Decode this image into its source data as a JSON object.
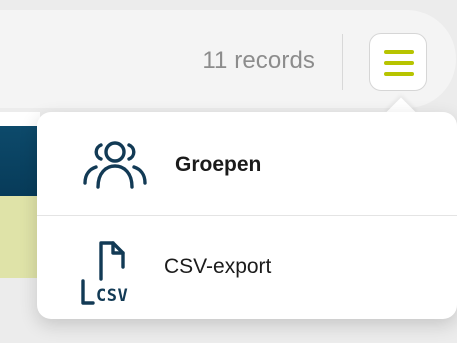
{
  "header": {
    "record_count": "11 records",
    "menu_button_icon": "hamburger-menu-icon",
    "accent_color": "#b7c400"
  },
  "menu": {
    "items": [
      {
        "label": "Groepen",
        "icon": "users-group-icon",
        "bold": true
      },
      {
        "label": "CSV-export",
        "icon": "csv-file-icon",
        "icon_text": "CSV"
      }
    ]
  }
}
